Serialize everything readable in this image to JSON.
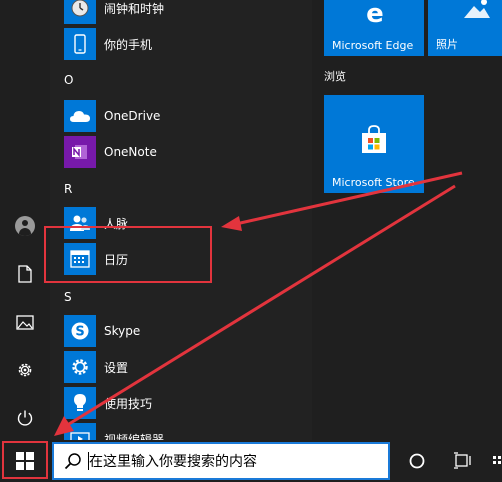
{
  "app_list": {
    "items": [
      {
        "label": "闹钟和时钟",
        "tile_color": "#0078d7",
        "icon": "alarm-clock-icon"
      },
      {
        "label": "你的手机",
        "tile_color": "#0078d7",
        "icon": "phone-icon"
      },
      {
        "label": "OneDrive",
        "tile_color": "#0078d7",
        "icon": "onedrive-icon"
      },
      {
        "label": "OneNote",
        "tile_color": "#7719aa",
        "icon": "onenote-icon"
      },
      {
        "label": "人脉",
        "tile_color": "#0078d7",
        "icon": "people-icon"
      },
      {
        "label": "日历",
        "tile_color": "#0078d7",
        "icon": "calendar-icon"
      },
      {
        "label": "Skype",
        "tile_color": "#0078d7",
        "icon": "skype-icon"
      },
      {
        "label": "设置",
        "tile_color": "#0078d7",
        "icon": "gear-icon"
      },
      {
        "label": "使用技巧",
        "tile_color": "#0078d7",
        "icon": "lightbulb-icon"
      },
      {
        "label": "视频编辑器",
        "tile_color": "#0078d7",
        "icon": "video-editor-icon"
      }
    ],
    "group_letters": [
      "O",
      "R",
      "S"
    ]
  },
  "tiles": {
    "edge_label": "Microsoft Edge",
    "photos_label": "照片",
    "browse_title": "浏览",
    "store_label": "Microsoft Store",
    "tile_color": "#0078d7"
  },
  "sidebar": {
    "icons": [
      "user-icon",
      "document-icon",
      "pictures-icon",
      "settings-icon",
      "power-icon"
    ]
  },
  "taskbar": {
    "search_placeholder": "在这里输入你要搜索的内容",
    "icons": [
      "windows-start-icon",
      "search-icon",
      "cortana-icon",
      "task-view-icon"
    ]
  },
  "annotations": {
    "color": "#e2343d"
  }
}
